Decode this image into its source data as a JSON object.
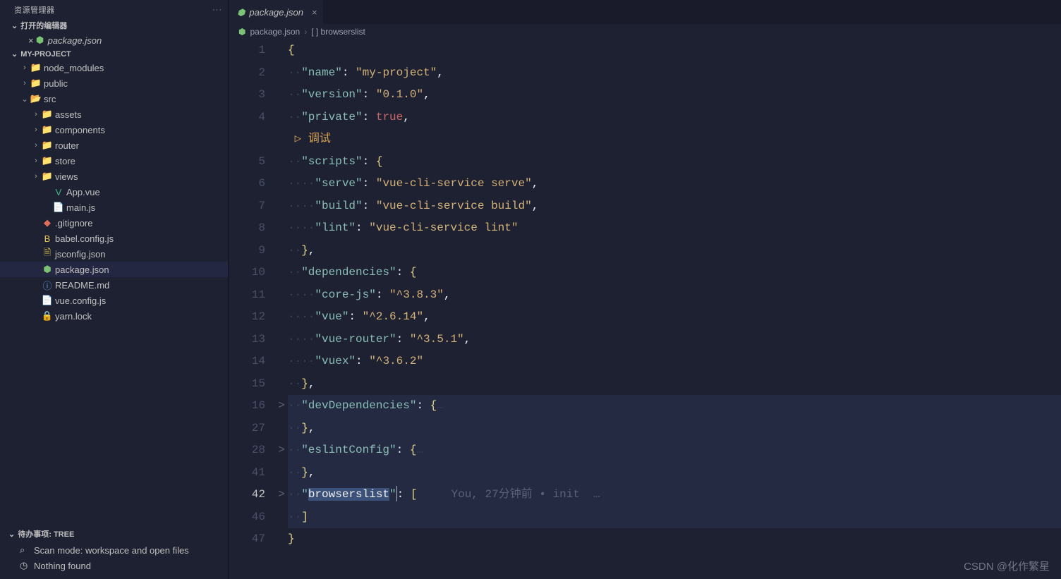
{
  "sidebar": {
    "explorer_label": "资源管理器",
    "open_editors_label": "打开的编辑器",
    "open_editors": [
      {
        "x_label": "×",
        "file": "package.json",
        "icon": "⬢"
      }
    ],
    "project_label": "MY-PROJECT",
    "tree": [
      {
        "label": "node_modules",
        "icon": "📁",
        "chev": "›",
        "cls": "ic-green",
        "indent": 1
      },
      {
        "label": "public",
        "icon": "📁",
        "chev": "›",
        "cls": "ic-blue",
        "indent": 1
      },
      {
        "label": "src",
        "icon": "📂",
        "chev": "⌄",
        "cls": "ic-teal",
        "indent": 1
      },
      {
        "label": "assets",
        "icon": "📁",
        "chev": "›",
        "cls": "ic-orange",
        "indent": 2
      },
      {
        "label": "components",
        "icon": "📁",
        "chev": "›",
        "cls": "ic-orange",
        "indent": 2
      },
      {
        "label": "router",
        "icon": "📁",
        "chev": "›",
        "cls": "ic-teal",
        "indent": 2
      },
      {
        "label": "store",
        "icon": "📁",
        "chev": "›",
        "cls": "ic-gray",
        "indent": 2
      },
      {
        "label": "views",
        "icon": "📁",
        "chev": "›",
        "cls": "ic-orange",
        "indent": 2
      },
      {
        "label": "App.vue",
        "icon": "V",
        "chev": "",
        "cls": "ic-vue",
        "indent": 3
      },
      {
        "label": "main.js",
        "icon": "📄",
        "chev": "",
        "cls": "ic-teal",
        "indent": 3
      },
      {
        "label": ".gitignore",
        "icon": "◆",
        "chev": "",
        "cls": "ic-red",
        "indent": 2
      },
      {
        "label": "babel.config.js",
        "icon": "B",
        "chev": "",
        "cls": "ic-yellow",
        "indent": 2
      },
      {
        "label": "jsconfig.json",
        "icon": "🗎",
        "chev": "",
        "cls": "ic-yellow",
        "indent": 2
      },
      {
        "label": "package.json",
        "icon": "⬢",
        "chev": "",
        "cls": "ic-green",
        "indent": 2,
        "active": true
      },
      {
        "label": "README.md",
        "icon": "ⓘ",
        "chev": "",
        "cls": "ic-info",
        "indent": 2
      },
      {
        "label": "vue.config.js",
        "icon": "📄",
        "chev": "",
        "cls": "ic-teal",
        "indent": 2
      },
      {
        "label": "yarn.lock",
        "icon": "🔒",
        "chev": "",
        "cls": "ic-blue",
        "indent": 2
      }
    ],
    "footer": {
      "title": "待办事项: TREE",
      "scan_mode_label": "Scan mode: workspace and open files",
      "nothing_found_label": "Nothing found"
    }
  },
  "editor": {
    "tab": {
      "file": "package.json"
    },
    "breadcrumb": {
      "file": "package.json",
      "path_label": "[ ] browserslist"
    },
    "lines": [
      "1",
      "2",
      "3",
      "4",
      "",
      "5",
      "6",
      "7",
      "8",
      "9",
      "10",
      "11",
      "12",
      "13",
      "14",
      "15",
      "16",
      "27",
      "28",
      "41",
      "42",
      "46",
      "47"
    ],
    "active_line_idx": 20,
    "debug_label": "调试",
    "blame_text": "You, 27分钟前 • init  …",
    "json": {
      "name": "my-project",
      "version": "0.1.0",
      "private_value": "true",
      "scripts": {
        "serve": "vue-cli-service serve",
        "build": "vue-cli-service build",
        "lint": "vue-cli-service lint"
      },
      "dependencies": {
        "core-js": "^3.8.3",
        "vue": "^2.6.14",
        "vue-router": "^3.5.1",
        "vuex": "^3.6.2"
      },
      "devDependencies_key": "devDependencies",
      "eslintConfig_key": "eslintConfig",
      "browserslist_key": "browserslist"
    }
  },
  "watermark": "CSDN @化作繁星"
}
